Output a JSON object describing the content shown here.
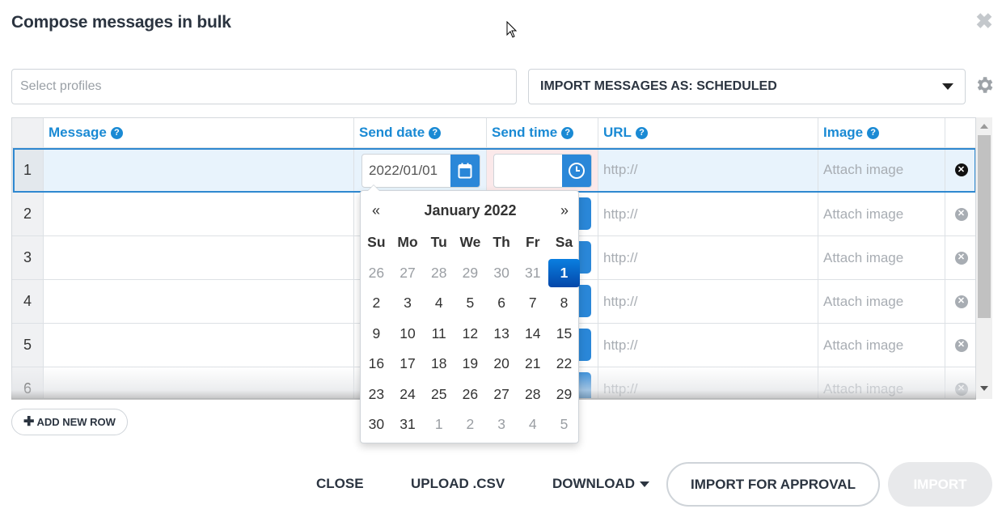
{
  "dialog": {
    "title": "Compose messages in bulk"
  },
  "profiles": {
    "placeholder": "Select profiles"
  },
  "import_mode": {
    "label": "IMPORT MESSAGES AS: SCHEDULED"
  },
  "columns": {
    "message": "Message",
    "send_date": "Send date",
    "send_time": "Send time",
    "url": "URL",
    "image": "Image"
  },
  "help_glyph": "?",
  "rows": [
    {
      "num": "1",
      "date": "2022/01/01",
      "time": "",
      "url": "http://",
      "image": "Attach image"
    },
    {
      "num": "2",
      "url": "http://",
      "image": "Attach image"
    },
    {
      "num": "3",
      "url": "http://",
      "image": "Attach image"
    },
    {
      "num": "4",
      "url": "http://",
      "image": "Attach image"
    },
    {
      "num": "5",
      "url": "http://",
      "image": "Attach image"
    },
    {
      "num": "6",
      "url": "http://",
      "image": "Attach image"
    }
  ],
  "datepicker": {
    "prev": "«",
    "next": "»",
    "month": "January 2022",
    "weekdays": [
      "Su",
      "Mo",
      "Tu",
      "We",
      "Th",
      "Fr",
      "Sa"
    ],
    "weeks": [
      [
        "26",
        "27",
        "28",
        "29",
        "30",
        "31",
        "1"
      ],
      [
        "2",
        "3",
        "4",
        "5",
        "6",
        "7",
        "8"
      ],
      [
        "9",
        "10",
        "11",
        "12",
        "13",
        "14",
        "15"
      ],
      [
        "16",
        "17",
        "18",
        "19",
        "20",
        "21",
        "22"
      ],
      [
        "23",
        "24",
        "25",
        "26",
        "27",
        "28",
        "29"
      ],
      [
        "30",
        "31",
        "1",
        "2",
        "3",
        "4",
        "5"
      ]
    ],
    "selected": "1"
  },
  "actions": {
    "add_row": "ADD NEW ROW",
    "close": "CLOSE",
    "upload_csv": "UPLOAD .CSV",
    "download": "DOWNLOAD",
    "import_for_approval": "IMPORT FOR APPROVAL",
    "import": "IMPORT"
  },
  "colors": {
    "accent": "#1a8ad4",
    "button_blue": "#2a87d8",
    "selected_day": "#0a6fd0",
    "selected_row": "#e8f3fc"
  },
  "icons": {
    "close": "close-icon",
    "settings": "gear-icon",
    "calendar": "calendar-icon",
    "clock": "clock-icon",
    "delete": "delete-row-icon",
    "plus": "plus-icon",
    "caret": "caret-down-icon"
  }
}
